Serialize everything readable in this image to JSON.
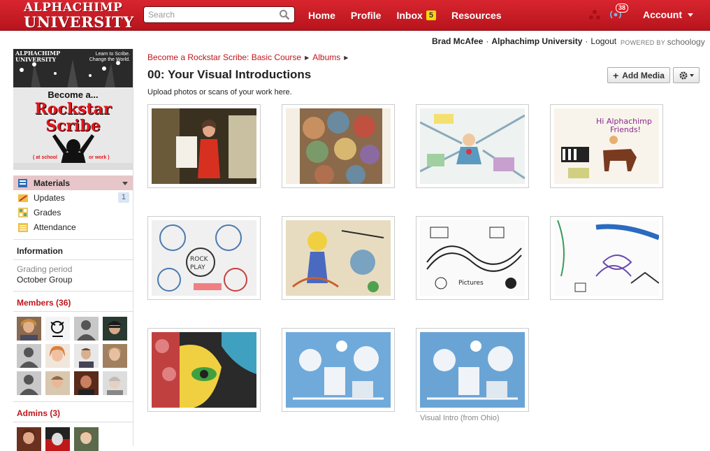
{
  "header": {
    "logo_line1": "ALPHACHIMP",
    "logo_line2": "UNIVERSITY",
    "search_placeholder": "Search",
    "nav": [
      {
        "label": "Home"
      },
      {
        "label": "Profile"
      },
      {
        "label": "Inbox",
        "badge": "5"
      },
      {
        "label": "Resources"
      }
    ],
    "notification_count": "38",
    "account_label": "Account"
  },
  "userbar": {
    "user_name": "Brad McAfee",
    "school": "Alphachimp University",
    "logout": "Logout",
    "powered_by": "POWERED BY",
    "powered_brand": "schoology"
  },
  "sidebar": {
    "banner": {
      "top_line1": "ALPHACHIMP",
      "top_line2": "UNIVERSITY",
      "tagline1": "Learn to Scribe.",
      "tagline2": "Change the World.",
      "become": "Become a...",
      "rock1": "Rockstar",
      "rock2": "Scribe",
      "sub1": "( at school",
      "sub2": "or work )"
    },
    "menu": [
      {
        "label": "Materials",
        "active": true
      },
      {
        "label": "Updates",
        "count": "1"
      },
      {
        "label": "Grades"
      },
      {
        "label": "Attendance"
      }
    ],
    "information_title": "Information",
    "grading_period_label": "Grading period",
    "grading_period_value": "October Group",
    "members_title": "Members (36)",
    "admins_title": "Admins (3)"
  },
  "main": {
    "breadcrumb": [
      "Become a Rockstar Scribe: Basic Course",
      "Albums"
    ],
    "title": "00: Your Visual Introductions",
    "description": "Upload photos or scans of your work here.",
    "add_media_label": "Add Media",
    "last_caption": "Visual Intro (from Ohio)"
  },
  "colors": {
    "brand_red": "#c8161e",
    "link_red": "#c0161c",
    "badge_yellow": "#f5d90a",
    "active_menu": "#e7c6c9"
  }
}
